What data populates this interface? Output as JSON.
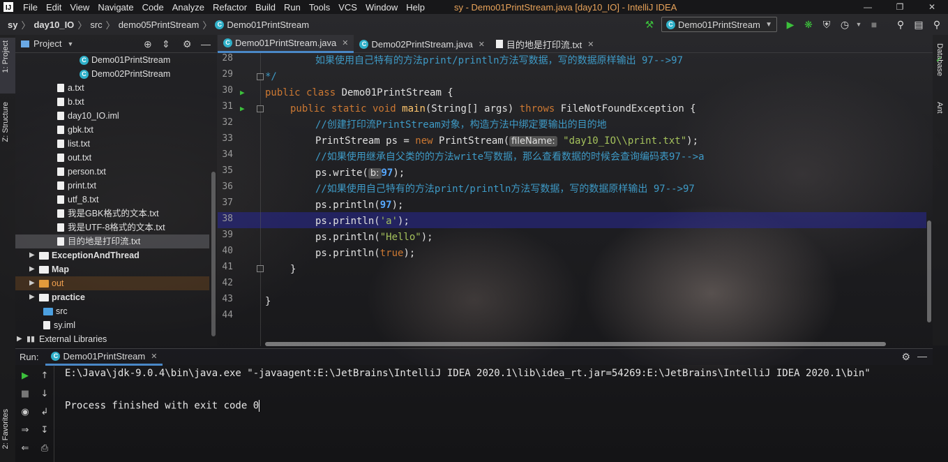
{
  "app": {
    "window_title": "sy - Demo01PrintStream.java [day10_IO] - IntelliJ IDEA",
    "menu": [
      "File",
      "Edit",
      "View",
      "Navigate",
      "Code",
      "Analyze",
      "Refactor",
      "Build",
      "Run",
      "Tools",
      "VCS",
      "Window",
      "Help"
    ]
  },
  "breadcrumb": [
    "sy",
    "day10_IO",
    "src",
    "demo05PrintStream",
    "Demo01PrintStream"
  ],
  "run_config": "Demo01PrintStream",
  "left_stripe": {
    "project_tab": "1: Project",
    "structure_tab": "Z: Structure",
    "favorites_tab": "2: Favorites"
  },
  "right_stripe": {
    "database_tab": "Database",
    "ant_tab": "Ant"
  },
  "project": {
    "header": "Project",
    "items": [
      {
        "label": "Demo01PrintStream",
        "type": "class"
      },
      {
        "label": "Demo02PrintStream",
        "type": "class"
      },
      {
        "label": "a.txt",
        "type": "file"
      },
      {
        "label": "b.txt",
        "type": "file"
      },
      {
        "label": "day10_IO.iml",
        "type": "file"
      },
      {
        "label": "gbk.txt",
        "type": "file"
      },
      {
        "label": "list.txt",
        "type": "file"
      },
      {
        "label": "out.txt",
        "type": "file"
      },
      {
        "label": "person.txt",
        "type": "file"
      },
      {
        "label": "print.txt",
        "type": "file"
      },
      {
        "label": "utf_8.txt",
        "type": "file"
      },
      {
        "label": "我是GBK格式的文本.txt",
        "type": "file"
      },
      {
        "label": "我是UTF-8格式的文本.txt",
        "type": "file"
      },
      {
        "label": "目的地是打印流.txt",
        "type": "file"
      },
      {
        "label": "ExceptionAndThread",
        "type": "folder"
      },
      {
        "label": "Map",
        "type": "folder"
      },
      {
        "label": "out",
        "type": "folder-orange"
      },
      {
        "label": "practice",
        "type": "folder"
      },
      {
        "label": "src",
        "type": "folder-blue"
      },
      {
        "label": "sy.iml",
        "type": "file"
      },
      {
        "label": "External Libraries",
        "type": "lib"
      }
    ]
  },
  "tabs": [
    {
      "label": "Demo01PrintStream.java",
      "active": true
    },
    {
      "label": "Demo02PrintStream.java",
      "active": false
    },
    {
      "label": "目的地是打印流.txt",
      "active": false
    }
  ],
  "editor": {
    "line_numbers": [
      "28",
      "29",
      "30",
      "31",
      "32",
      "33",
      "34",
      "35",
      "36",
      "37",
      "38",
      "39",
      "40",
      "41",
      "42",
      "43",
      "44"
    ],
    "current_line": "38",
    "code": {
      "l28": "如果使用自己特有的方法print/println方法写数据，写的数据原样输出 97-->97",
      "l29": "*/",
      "l30_kw": "public class",
      "l30_name": " Demo01PrintStream {",
      "l31_kw1": "public static void",
      "l31_fn": "main",
      "l31_args": "(String[] args) ",
      "l31_kw2": "throws",
      "l31_rest": " FileNotFoundException {",
      "l32": "//创建打印流PrintStream对象，构造方法中绑定要输出的目的地",
      "l33_a": "PrintStream ps = ",
      "l33_kw": "new",
      "l33_b": " PrintStream(",
      "l33_hint": "fileName:",
      "l33_str": "\"day10_IO\\\\print.txt\"",
      "l33_c": ");",
      "l34": "//如果使用继承自父类的的方法write写数据，那么查看数据的时候会查询编码表97-->a",
      "l35_a": "ps.write(",
      "l35_hint": "b:",
      "l35_num": "97",
      "l35_c": ");",
      "l36": "//如果使用自己特有的方法print/println方法写数据，写的数据原样输出 97-->97",
      "l37_a": "ps.println(",
      "l37_num": "97",
      "l37_c": ");",
      "l38_a": "ps.println(",
      "l38_str": "'a'",
      "l38_c": ");",
      "l39_a": "ps.println(",
      "l39_str": "\"Hello\"",
      "l39_c": ");",
      "l40_a": "ps.println(",
      "l40_kw": "true",
      "l40_c": ");",
      "l41": "}",
      "l43": "}"
    }
  },
  "run": {
    "label": "Run:",
    "tab": "Demo01PrintStream",
    "console": [
      "E:\\Java\\jdk-9.0.4\\bin\\java.exe \"-javaagent:E:\\JetBrains\\IntelliJ IDEA 2020.1\\lib\\idea_rt.jar=54269:E:\\JetBrains\\IntelliJ IDEA 2020.1\\bin\"",
      "",
      "Process finished with exit code 0"
    ]
  },
  "colors": {
    "accent": "#4a88c7",
    "title": "#e8a35a",
    "keyword": "#cc7832",
    "comment": "#3e9ac6",
    "current_line": "#28289a"
  }
}
